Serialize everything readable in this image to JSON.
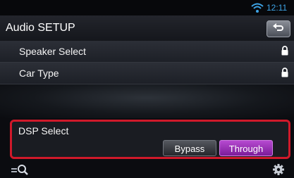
{
  "status": {
    "time": "12:11",
    "wifi_icon": "wifi-icon"
  },
  "header": {
    "title": "Audio SETUP",
    "back_icon": "back-icon"
  },
  "menu": [
    {
      "label": "Speaker Select",
      "icon": "lock-icon"
    },
    {
      "label": "Car Type",
      "icon": "lock-icon"
    }
  ],
  "dsp": {
    "label": "DSP Select",
    "options": [
      "Bypass",
      "Through"
    ],
    "selected": "Through",
    "highlight_color": "#d0192a",
    "selected_color": "#9b2fbd"
  },
  "footer": {
    "left_icon": "search-icon",
    "right_icon": "gear-icon"
  }
}
